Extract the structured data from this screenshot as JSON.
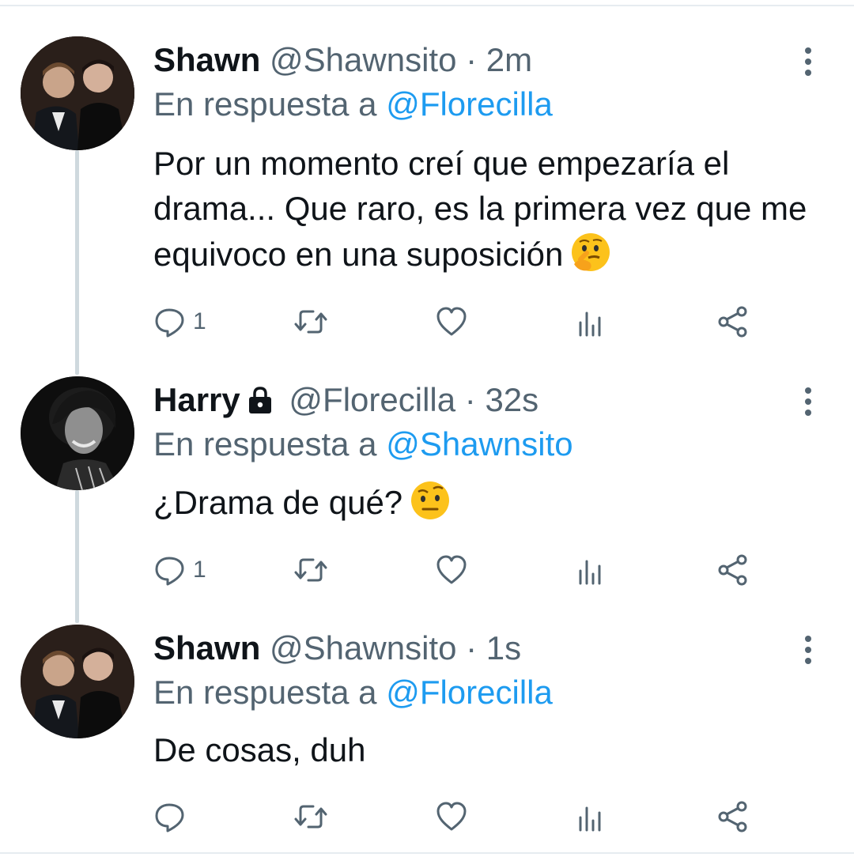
{
  "tweets": [
    {
      "name": "Shawn",
      "handle": "@Shawnsito",
      "time": "2m",
      "reply_prefix": "En respuesta a",
      "reply_to": "@Florecilla",
      "text": "Por un momento creí que empezaría el drama... Que raro, es la primera vez que me equivoco en una suposición",
      "emoji": "thinking-face",
      "reply_count": "1",
      "avatar": "shawn-avatar",
      "locked": false
    },
    {
      "name": "Harry",
      "handle": "@Florecilla",
      "time": "32s",
      "reply_prefix": "En respuesta a",
      "reply_to": "@Shawnsito",
      "text": "¿Drama de qué?",
      "emoji": "raised-eyebrow-face",
      "reply_count": "1",
      "avatar": "harry-avatar",
      "locked": true
    },
    {
      "name": "Shawn",
      "handle": "@Shawnsito",
      "time": "1s",
      "reply_prefix": "En respuesta a",
      "reply_to": "@Florecilla",
      "text": "De cosas, duh",
      "emoji": "",
      "reply_count": "",
      "avatar": "shawn-avatar",
      "locked": false
    }
  ],
  "separator": "·",
  "colors": {
    "mention": "#1d9bf0",
    "secondary": "#536471",
    "text": "#0f1419",
    "thread_line": "#cfd9de"
  },
  "icons": [
    "reply-icon",
    "retweet-icon",
    "like-icon",
    "views-icon",
    "share-icon",
    "more-icon",
    "lock-icon"
  ]
}
